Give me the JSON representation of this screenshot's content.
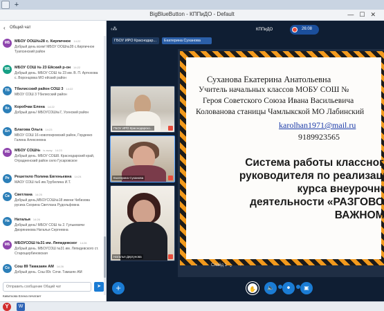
{
  "window": {
    "title": "BigBlueButton - КППиДО - Default",
    "new_tab": "+"
  },
  "chat": {
    "back_icon": "chevron-left",
    "header": "Общий чат",
    "messages": [
      {
        "initials": "МБ",
        "color": "#8e44ad",
        "name": "МБОУ ООШ№28 с. Кирпичное",
        "time": "14:22",
        "text": "Добрый день всем! МБОУ ООШ№28 с.Кирпичное Туапсинский район"
      },
      {
        "initials": "МБ",
        "color": "#16a085",
        "name": "МБОУ СОШ № 23 Ейский р-он",
        "time": "14:22",
        "text": "Добрый день. МБОУ СОШ № 23 им. В. П. Артюхова с. Воронцовка МО ейский район"
      },
      {
        "initials": "ТБ",
        "color": "#2c7fb8",
        "name": "Тбилисский район СОШ 3",
        "time": "14:22",
        "text": "МБОУ СОШ 3 Тбилисский район"
      },
      {
        "initials": "Ко",
        "color": "#2c7fb8",
        "name": "Коробчак Елена",
        "time": "14:22",
        "text": "Добрый день! МБОУСОШ№7, Усенский район"
      },
      {
        "initials": "Бл",
        "color": "#2c7fb8",
        "name": "Благова Ольга",
        "time": "14:23",
        "text": "МБОУ СОШ 16 новопокровский район, Горденко Галина Алексеевна"
      },
      {
        "initials": "МБ",
        "color": "#8e44ad",
        "name": "МБОУ СОШ№",
        "time": "14:23",
        "status": "is away",
        "text": "Добрый день. МБОУ СОШ8. Краснодарский край, Отрадненский район село Гусаровское"
      },
      {
        "initials": "Ре",
        "color": "#2c7fb8",
        "name": "Решетило Полина Евгеньевна",
        "time": "14:24",
        "text": "МАОУ СОШ №6 им.Трубилина И.Т."
      },
      {
        "initials": "Св",
        "color": "#2c7fb8",
        "name": "Светлана",
        "time": "14:25",
        "text": "Добрый день,МБОУСОШ№18 имени Чибизова русика Скорина Светлана Рудольфовна"
      },
      {
        "initials": "На",
        "color": "#2c7fb8",
        "name": "Наталья",
        "time": "14:26",
        "text": "Добрый день! МБОУ СОШ № 2. Гулькевичи Дворянинова Наталья Сергеевна"
      },
      {
        "initials": "МБ",
        "color": "#8e44ad",
        "name": "МБОУСОШ №31 им. Ляпидевског",
        "time": "14:26",
        "text": "Добрый день. МБОУСОШ №31 им. Ляпидевского ст. Старощербиновская"
      },
      {
        "initials": "Со",
        "color": "#2c7fb8",
        "name": "Сош 89 Тамазаян АМ",
        "time": "14:26",
        "text": "Добрый день. Сош 89г. Сочи. Тамазян АМ"
      }
    ],
    "input_placeholder": "Отправить сообщение Общий чат",
    "send_icon": "send-arrow",
    "typing": "Кивиткова Елена печатает"
  },
  "main": {
    "collapse_label": "‹⁂",
    "room_name": "КППиДО",
    "record_time": "26:08",
    "talkers": [
      "ГБОУ ИРО Краснодар...",
      "Екатерина Суханова"
    ],
    "cams": [
      {
        "label": "ГБОУ ИРО Краснодарско..."
      },
      {
        "label": "Екатерина Суханова"
      },
      {
        "label": "Наталья Дергунова"
      }
    ],
    "slide": {
      "line1": "Суханова Екатерина Анатольевна",
      "line2": "Учитель начальных классов МОБУ СОШ №",
      "line3": "Героя Советского Союза Ивана Васильевича",
      "line4": "Колованова станицы Чамлыкской МО Лабинский",
      "email": "karolhan1971@mail.ru",
      "phone": "9189923565",
      "bold1": "Система работы классного",
      "bold2": "руководителя по реализации",
      "bold3": "курса внеурочной",
      "bold4": "деятельности «РАЗГОВОРЫ О",
      "bold5": "ВАЖНОМ»"
    },
    "slide_nav": {
      "label": "Слайд 1",
      "prev": "‹",
      "next": "›",
      "chev": "⌄"
    },
    "actions": {
      "plus": "+"
    }
  }
}
